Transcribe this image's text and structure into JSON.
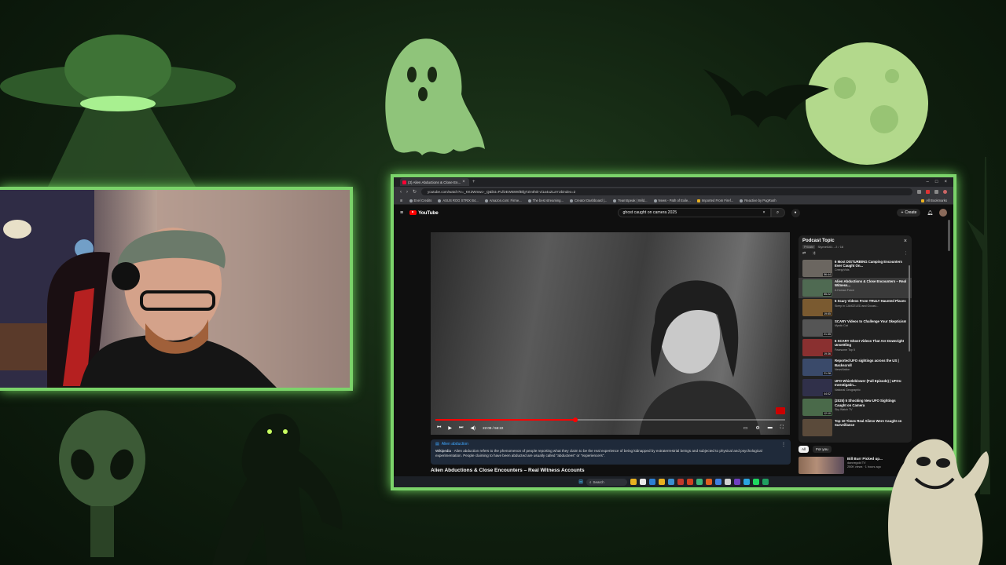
{
  "browser": {
    "tab_title": "(3) Alien Abductions & Close En...",
    "url": "youtube.com/watch?v=_KK3Wmwo-_Q&list=PLfDEWBW6fBfgTZmth0i-vi1a4uZLaYUbindex=2",
    "bookmarks": [
      "Enel Credits",
      "ASUS ROG STRIX B4...",
      "Amazon.com: Firme...",
      "The best streaming...",
      "Creator Dashboard |...",
      "TeamSpeak | Wild...",
      "News - Path of Exile...",
      "Imported From Firef...",
      "Reactive by PugRush"
    ],
    "all_bookmarks_label": "All Bookmarks"
  },
  "youtube": {
    "logo_text": "YouTube",
    "search_query": "ghost caught on camera 2025",
    "create_label": "Create"
  },
  "player": {
    "time": "22:09 / 55:22",
    "progress": 0.4
  },
  "info_panel": {
    "title": "Alien abduction",
    "source": "Wikipedia",
    "text": "Alien abduction refers to the phenomenon of people reporting what they claim to be the real experience of being kidnapped by extraterrestrial beings and subjected to physical and psychological experimentation. People claiming to have been abducted are usually called \"abductees\" or \"experiencers\"."
  },
  "video_title": "Alien Abductions & Close Encounters – Real Witness Accounts",
  "playlist": {
    "title": "Podcast Topic",
    "privacy": "Private",
    "count": "Stymet161 - 2 / 16",
    "items": [
      {
        "title": "6 Most DISTURBING Camping Encounters Ever Caught On...",
        "channel": "CreepyVids",
        "duration": "56:44",
        "color": "#6b6660"
      },
      {
        "title": "Alien Abductions & Close Encounters – Real Witness...",
        "channel": "A Human Force",
        "duration": "55:22",
        "color": "#4f6a52"
      },
      {
        "title": "5 Scary Videos From TRULY Haunted Places",
        "channel": "Sleep in CANCELED and Occasi...",
        "duration": "19:55",
        "color": "#7a5a30"
      },
      {
        "title": "SCARY Videos to Challenge Your Skepticism",
        "channel": "Mystic Cat",
        "duration": "21:35",
        "color": "#555555"
      },
      {
        "title": "6 SCARY Ghost Videos That Are Downright Unsettling",
        "channel": "Fearsome Top 5",
        "duration": "19:36",
        "color": "#8a3030"
      },
      {
        "title": "Reported UFO sightings across the US | Backscroll",
        "channel": "NewsNation",
        "duration": "21:28",
        "color": "#3a4a6a"
      },
      {
        "title": "UFO Whistleblower (Full Episode) | UFOs: Investigatin...",
        "channel": "National Geographic",
        "duration": "44:02",
        "color": "#30304a"
      },
      {
        "title": "(2025) 5 Shocking New UFO Sightings Caught on Camera",
        "channel": "Sky Watch TV",
        "duration": "12:10",
        "color": "#4a6a4a"
      },
      {
        "title": "Top 10 Times Real Aliens Were Caught on Surveillance",
        "channel": "",
        "duration": "",
        "color": "#5a4a3a"
      }
    ]
  },
  "chips": [
    "All",
    "For you"
  ],
  "recommended": {
    "title": "Bill Burr Picked up...",
    "channel": "dannegold TV",
    "meta": "250K views · 1 hours ago"
  },
  "taskbar": {
    "search_label": "Search",
    "apps": [
      "#e8b020",
      "#e8e8e8",
      "#2d7fd3",
      "#e8b020",
      "#3c8fd0",
      "#c0392b",
      "#d04020",
      "#3cb37a",
      "#e06020",
      "#4080e0",
      "#d0d0d0",
      "#7040c0",
      "#2aa5e0",
      "#1ed760",
      "#20a060"
    ]
  },
  "colors": {
    "frame_glow": "#7bd36a",
    "yt_red": "#ff0000"
  }
}
